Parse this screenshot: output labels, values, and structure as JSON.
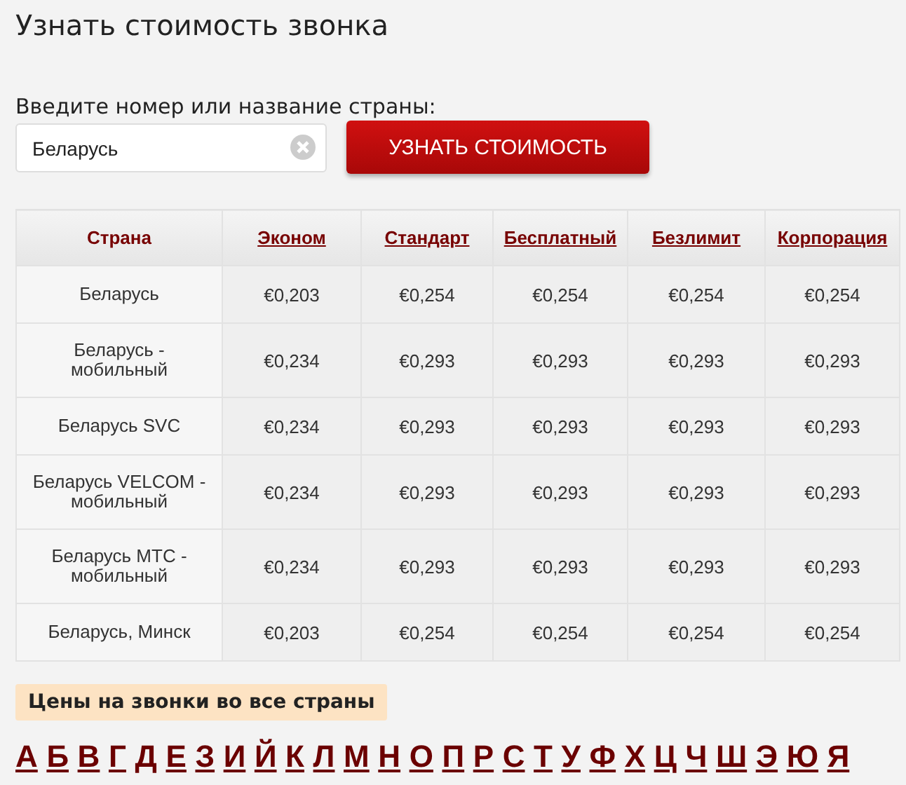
{
  "title": "Узнать стоимость звонка",
  "search": {
    "label": "Введите номер или название страны:",
    "value": "Беларусь",
    "button": "УЗНАТЬ СТОИМОСТЬ"
  },
  "table": {
    "columns": [
      {
        "label": "Страна",
        "kind": "plain"
      },
      {
        "label": "Эконом",
        "kind": "link"
      },
      {
        "label": "Стандарт",
        "kind": "link"
      },
      {
        "label": "Бесплатный",
        "kind": "link"
      },
      {
        "label": "Безлимит",
        "kind": "link"
      },
      {
        "label": "Корпорация",
        "kind": "link"
      }
    ],
    "rows": [
      [
        "Беларусь",
        "€0,203",
        "€0,254",
        "€0,254",
        "€0,254",
        "€0,254"
      ],
      [
        "Беларусь - мобильный",
        "€0,234",
        "€0,293",
        "€0,293",
        "€0,293",
        "€0,293"
      ],
      [
        "Беларусь SVC",
        "€0,234",
        "€0,293",
        "€0,293",
        "€0,293",
        "€0,293"
      ],
      [
        "Беларусь VELCOM - мобильный",
        "€0,234",
        "€0,293",
        "€0,293",
        "€0,293",
        "€0,293"
      ],
      [
        "Беларусь МТС - мобильный",
        "€0,234",
        "€0,293",
        "€0,293",
        "€0,293",
        "€0,293"
      ],
      [
        "Беларусь, Минск",
        "€0,203",
        "€0,254",
        "€0,254",
        "€0,254",
        "€0,254"
      ]
    ]
  },
  "all_countries": "Цены на звонки во все страны",
  "letters": [
    "А",
    "Б",
    "В",
    "Г",
    "Д",
    "Е",
    "З",
    "И",
    "Й",
    "К",
    "Л",
    "М",
    "Н",
    "О",
    "П",
    "Р",
    "С",
    "Т",
    "У",
    "Ф",
    "Х",
    "Ц",
    "Ч",
    "Ш",
    "Э",
    "Ю",
    "Я"
  ]
}
